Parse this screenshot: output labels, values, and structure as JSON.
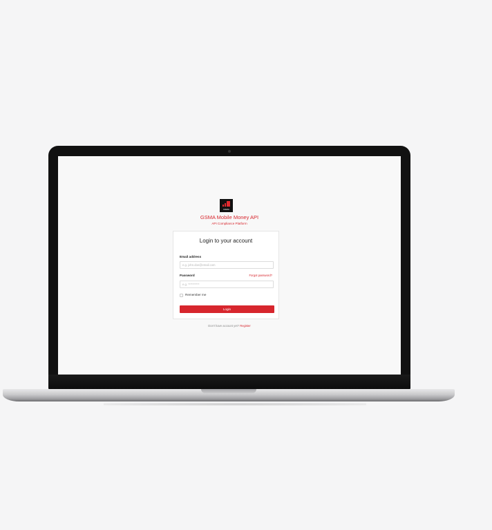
{
  "brand": {
    "logo_text": "GSMA",
    "title": "GSMA Mobile Money API",
    "subtitle": "API Compliance Platform",
    "accent_color": "#d7262d"
  },
  "login": {
    "heading": "Login to your account",
    "email_label": "Email address",
    "email_placeholder": "e.g. john.doe@email.com",
    "email_value": "",
    "password_label": "Password",
    "forgot_password": "Forgot password?",
    "password_placeholder": "e.g. **********",
    "password_value": "",
    "remember_me": "Remember me",
    "remember_checked": false,
    "submit_label": "Login"
  },
  "footer": {
    "prompt": "Don't have account yet?",
    "register_link": "Register"
  }
}
